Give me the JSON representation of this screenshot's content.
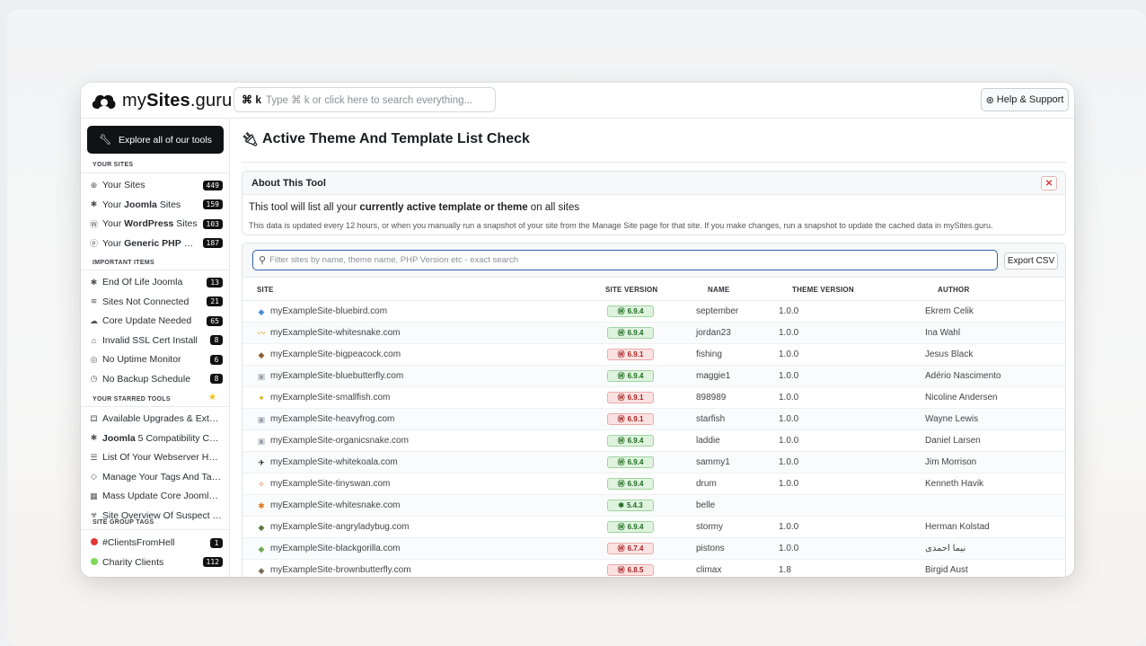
{
  "app": {
    "logo_text_plain": "my",
    "logo_text_bold": "Sites",
    "logo_text_suffix": ".guru"
  },
  "search": {
    "shortcut": "⌘ k",
    "placeholder": "Type ⌘ k or click here to search everything..."
  },
  "help_button": "Help & Support",
  "sidebar": {
    "explore_label": "Explore all of our tools",
    "sections": {
      "your_sites": "YOUR SITES",
      "important": "IMPORTANT ITEMS",
      "starred": "YOUR STARRED TOOLS",
      "group_tags": "SITE GROUP TAGS"
    },
    "your_sites": [
      {
        "pre": "Your Sites",
        "bold": "",
        "post": "",
        "count": "449",
        "icon": "globe-icon"
      },
      {
        "pre": "Your ",
        "bold": "Joomla",
        "post": " Sites",
        "count": "159",
        "icon": "joomla-icon"
      },
      {
        "pre": "Your ",
        "bold": "WordPress",
        "post": " Sites",
        "count": "103",
        "icon": "wordpress-icon"
      },
      {
        "pre": "Your ",
        "bold": "Generic PHP",
        "post": " Sites",
        "count": "187",
        "icon": "php-icon"
      }
    ],
    "important": [
      {
        "label": "End Of Life Joomla",
        "count": "13",
        "icon": "joomla-icon"
      },
      {
        "label": "Sites Not Connected",
        "count": "21",
        "icon": "disconnected-icon"
      },
      {
        "label": "Core Update Needed",
        "count": "65",
        "icon": "cloud-upload-icon"
      },
      {
        "label": "Invalid SSL Cert Install",
        "count": "8",
        "icon": "lock-icon"
      },
      {
        "label": "No Uptime Monitor",
        "count": "6",
        "icon": "target-icon"
      },
      {
        "label": "No Backup Schedule",
        "count": "8",
        "icon": "clock-icon"
      }
    ],
    "starred": [
      {
        "pre": "Available Upgrades & Extensi...",
        "bold": "",
        "post": "",
        "icon": "sitemap-icon"
      },
      {
        "pre": "",
        "bold": "Joomla",
        "post": " 5 Compatibility Chec...",
        "icon": "joomla-icon"
      },
      {
        "pre": "List Of Your Webserver Host ...",
        "bold": "",
        "post": "",
        "icon": "server-icon"
      },
      {
        "pre": "Manage Your Tags And Taggi...",
        "bold": "",
        "post": "",
        "icon": "tag-icon"
      },
      {
        "pre": "Mass Update Core Joomla/",
        "bold": "W...",
        "post": "",
        "icon": "calendar-icon"
      },
      {
        "pre": "Site Overview Of Suspect Co...",
        "bold": "",
        "post": "",
        "icon": "biohazard-icon"
      }
    ],
    "tags": [
      {
        "label": "#ClientsFromHell",
        "count": "1",
        "color": "#e53935"
      },
      {
        "label": "Charity Clients",
        "count": "112",
        "color": "#7ed957"
      }
    ]
  },
  "page": {
    "title": "Active Theme And Template List Check",
    "about": {
      "heading": "About This Tool",
      "line1_pre": "This tool will list all your ",
      "line1_bold": "currently active template or theme",
      "line1_post": " on all sites",
      "line2": "This data is updated every 12 hours, or when you manually run a snapshot of your site from the Manage Site page for that site. If you make changes, run a snapshot to update the cached data in mySites.guru."
    },
    "filter_placeholder": "Filter sites by name, theme name, PHP Version etc - exact search",
    "export_label": "Export CSV"
  },
  "table": {
    "headers": [
      "SITE",
      "SITE VERSION",
      "NAME",
      "THEME VERSION",
      "AUTHOR"
    ],
    "rows": [
      {
        "site": "myExampleSite-bluebird.com",
        "version": "6.9.4",
        "status": "good",
        "cms": "wp",
        "name": "september",
        "theme_version": "1.0.0",
        "author": "Ekrem Celik",
        "fav": "◆",
        "fav_color": "#4a90d9"
      },
      {
        "site": "myExampleSite-whitesnake.com",
        "version": "6.9.4",
        "status": "good",
        "cms": "wp",
        "name": "jordan23",
        "theme_version": "1.0.0",
        "author": "Ina Wahl",
        "fav": "〰",
        "fav_color": "#d4a017"
      },
      {
        "site": "myExampleSite-bigpeacock.com",
        "version": "6.9.1",
        "status": "bad",
        "cms": "wp",
        "name": "fishing",
        "theme_version": "1.0.0",
        "author": "Jesus Black",
        "fav": "◆",
        "fav_color": "#8b5a2b"
      },
      {
        "site": "myExampleSite-bluebutterfly.com",
        "version": "6.9.4",
        "status": "good",
        "cms": "wp",
        "name": "maggie1",
        "theme_version": "1.0.0",
        "author": "Adério Nascimento",
        "fav": "▣",
        "fav_color": "#9aa3ad"
      },
      {
        "site": "myExampleSite-smallfish.com",
        "version": "6.9.1",
        "status": "bad",
        "cms": "wp",
        "name": "898989",
        "theme_version": "1.0.0",
        "author": "Nicoline Andersen",
        "fav": "✦",
        "fav_color": "#e0b000"
      },
      {
        "site": "myExampleSite-heavyfrog.com",
        "version": "6.9.1",
        "status": "bad",
        "cms": "wp",
        "name": "starfish",
        "theme_version": "1.0.0",
        "author": "Wayne Lewis",
        "fav": "▣",
        "fav_color": "#9aa3ad"
      },
      {
        "site": "myExampleSite-organicsnake.com",
        "version": "6.9.4",
        "status": "good",
        "cms": "wp",
        "name": "laddie",
        "theme_version": "1.0.0",
        "author": "Daniel Larsen",
        "fav": "▣",
        "fav_color": "#9aa3ad"
      },
      {
        "site": "myExampleSite-whitekoala.com",
        "version": "6.9.4",
        "status": "good",
        "cms": "wp",
        "name": "sammy1",
        "theme_version": "1.0.0",
        "author": "Jim Morrison",
        "fav": "✈",
        "fav_color": "#111111"
      },
      {
        "site": "myExampleSite-tinyswan.com",
        "version": "6.9.4",
        "status": "good",
        "cms": "wp",
        "name": "drum",
        "theme_version": "1.0.0",
        "author": "Kenneth Havik",
        "fav": "✧",
        "fav_color": "#e06030"
      },
      {
        "site": "myExampleSite-whitesnake.com",
        "version": "5.4.3",
        "status": "good",
        "cms": "joomla",
        "name": "belle",
        "theme_version": "",
        "author": "",
        "fav": "✱",
        "fav_color": "#e8731e"
      },
      {
        "site": "myExampleSite-angryladybug.com",
        "version": "6.9.4",
        "status": "good",
        "cms": "wp",
        "name": "stormy",
        "theme_version": "1.0.0",
        "author": "Herman Kolstad",
        "fav": "◆",
        "fav_color": "#5a7a3a"
      },
      {
        "site": "myExampleSite-blackgorilla.com",
        "version": "6.7.4",
        "status": "bad",
        "cms": "wp",
        "name": "pistons",
        "theme_version": "1.0.0",
        "author": "نیما احمدی",
        "fav": "◆",
        "fav_color": "#6aa84f"
      },
      {
        "site": "myExampleSite-brownbutterfly.com",
        "version": "6.8.5",
        "status": "bad",
        "cms": "wp",
        "name": "climax",
        "theme_version": "1.8",
        "author": "Birgid Aust",
        "fav": "◆",
        "fav_color": "#7a6a55"
      }
    ]
  }
}
